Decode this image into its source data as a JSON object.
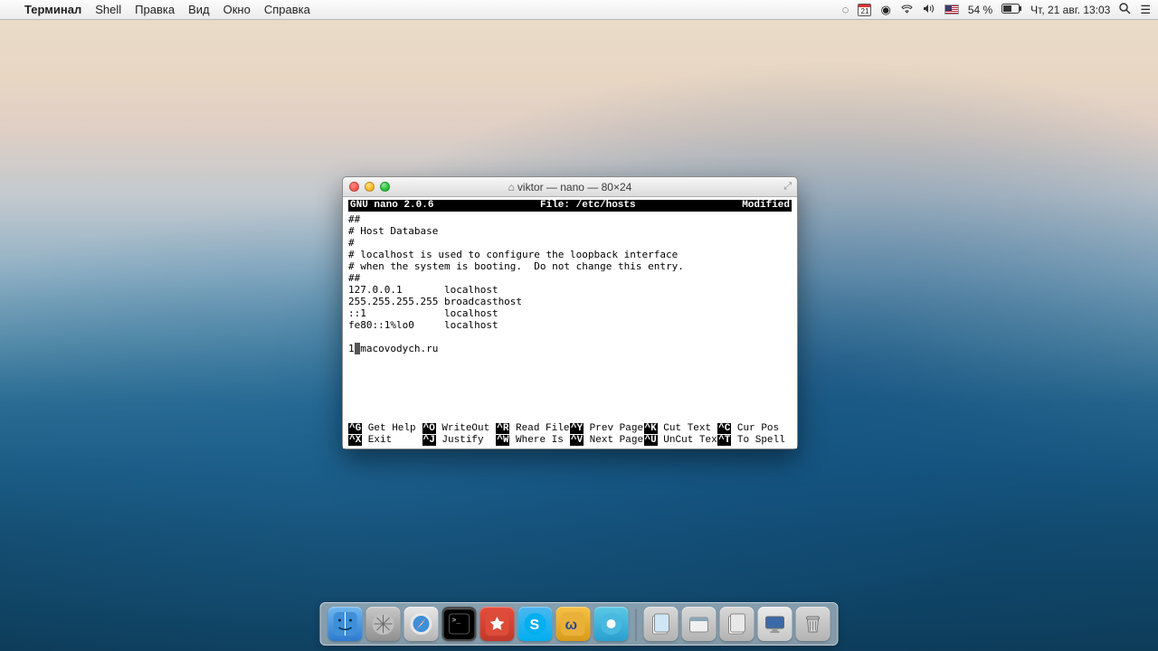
{
  "menubar": {
    "app_name": "Терминал",
    "items": [
      "Shell",
      "Правка",
      "Вид",
      "Окно",
      "Справка"
    ],
    "right": {
      "calendar_day": "21",
      "battery_pct": "54 %",
      "datetime": "Чт, 21 авг.  13:03"
    }
  },
  "window": {
    "title": "viktor — nano — 80×24"
  },
  "nano": {
    "header_left": "  GNU nano 2.0.6",
    "header_center": "File: /etc/hosts",
    "header_right": "Modified ",
    "body_lines": [
      "##",
      "# Host Database",
      "#",
      "# localhost is used to configure the loopback interface",
      "# when the system is booting.  Do not change this entry.",
      "##",
      "127.0.0.1       localhost",
      "255.255.255.255 broadcasthost",
      "::1             localhost",
      "fe80::1%lo0     localhost",
      "",
      "1"
    ],
    "cursor_tail": "macovodych.ru",
    "shortcuts_row1": [
      {
        "k": "^G",
        "l": " Get Help  "
      },
      {
        "k": "^O",
        "l": " WriteOut  "
      },
      {
        "k": "^R",
        "l": " Read File "
      },
      {
        "k": "^Y",
        "l": " Prev Page "
      },
      {
        "k": "^K",
        "l": " Cut Text  "
      },
      {
        "k": "^C",
        "l": " Cur Pos"
      }
    ],
    "shortcuts_row2": [
      {
        "k": "^X",
        "l": " Exit      "
      },
      {
        "k": "^J",
        "l": " Justify   "
      },
      {
        "k": "^W",
        "l": " Where Is  "
      },
      {
        "k": "^V",
        "l": " Next Page "
      },
      {
        "k": "^U",
        "l": " UnCut Text"
      },
      {
        "k": "^T",
        "l": " To Spell"
      }
    ]
  },
  "dock": {
    "items": [
      "finder",
      "launchpad",
      "safari",
      "terminal",
      "wunderlist",
      "skype",
      "wacom",
      "app",
      "|",
      "documents",
      "downloads",
      "display",
      "trash"
    ]
  }
}
